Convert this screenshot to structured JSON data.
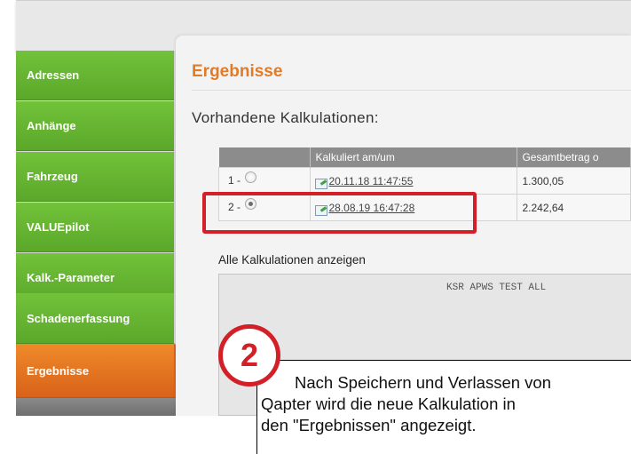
{
  "sidebar": {
    "items": [
      {
        "label": "Adressen"
      },
      {
        "label": "Anhänge"
      },
      {
        "label": "Fahrzeug"
      },
      {
        "label": "VALUEpilot"
      },
      {
        "label": "Kalk.-Parameter"
      },
      {
        "label": "Schadenerfassung"
      },
      {
        "label": "Ergebnisse",
        "active": true
      }
    ]
  },
  "main": {
    "title": "Ergebnisse",
    "subtitle": "Vorhandene Kalkulationen:",
    "table": {
      "columns": [
        "",
        "Kalkuliert am/um",
        "Gesamtbetrag o"
      ],
      "rows": [
        {
          "index": "1 -",
          "selected": false,
          "date": "20.11.18 11:47:55",
          "amount": "1.300,05"
        },
        {
          "index": "2 -",
          "selected": true,
          "date": "28.08.19 16:47:28",
          "amount": "2.242,64"
        }
      ]
    },
    "show_all_label": "Alle Kalkulationen anzeigen",
    "textbox_content": "KSR APWS TEST ALL"
  },
  "callout": {
    "number": "2",
    "lines": [
      "Nach Speichern und Verlassen von",
      "Qapter wird die neue Kalkulation in",
      "den \"Ergebnissen\" angezeigt."
    ]
  },
  "colors": {
    "nav_green": "#62b22f",
    "nav_active_orange": "#e87625",
    "title_orange": "#e07b28",
    "highlight_red": "#d31f27"
  }
}
